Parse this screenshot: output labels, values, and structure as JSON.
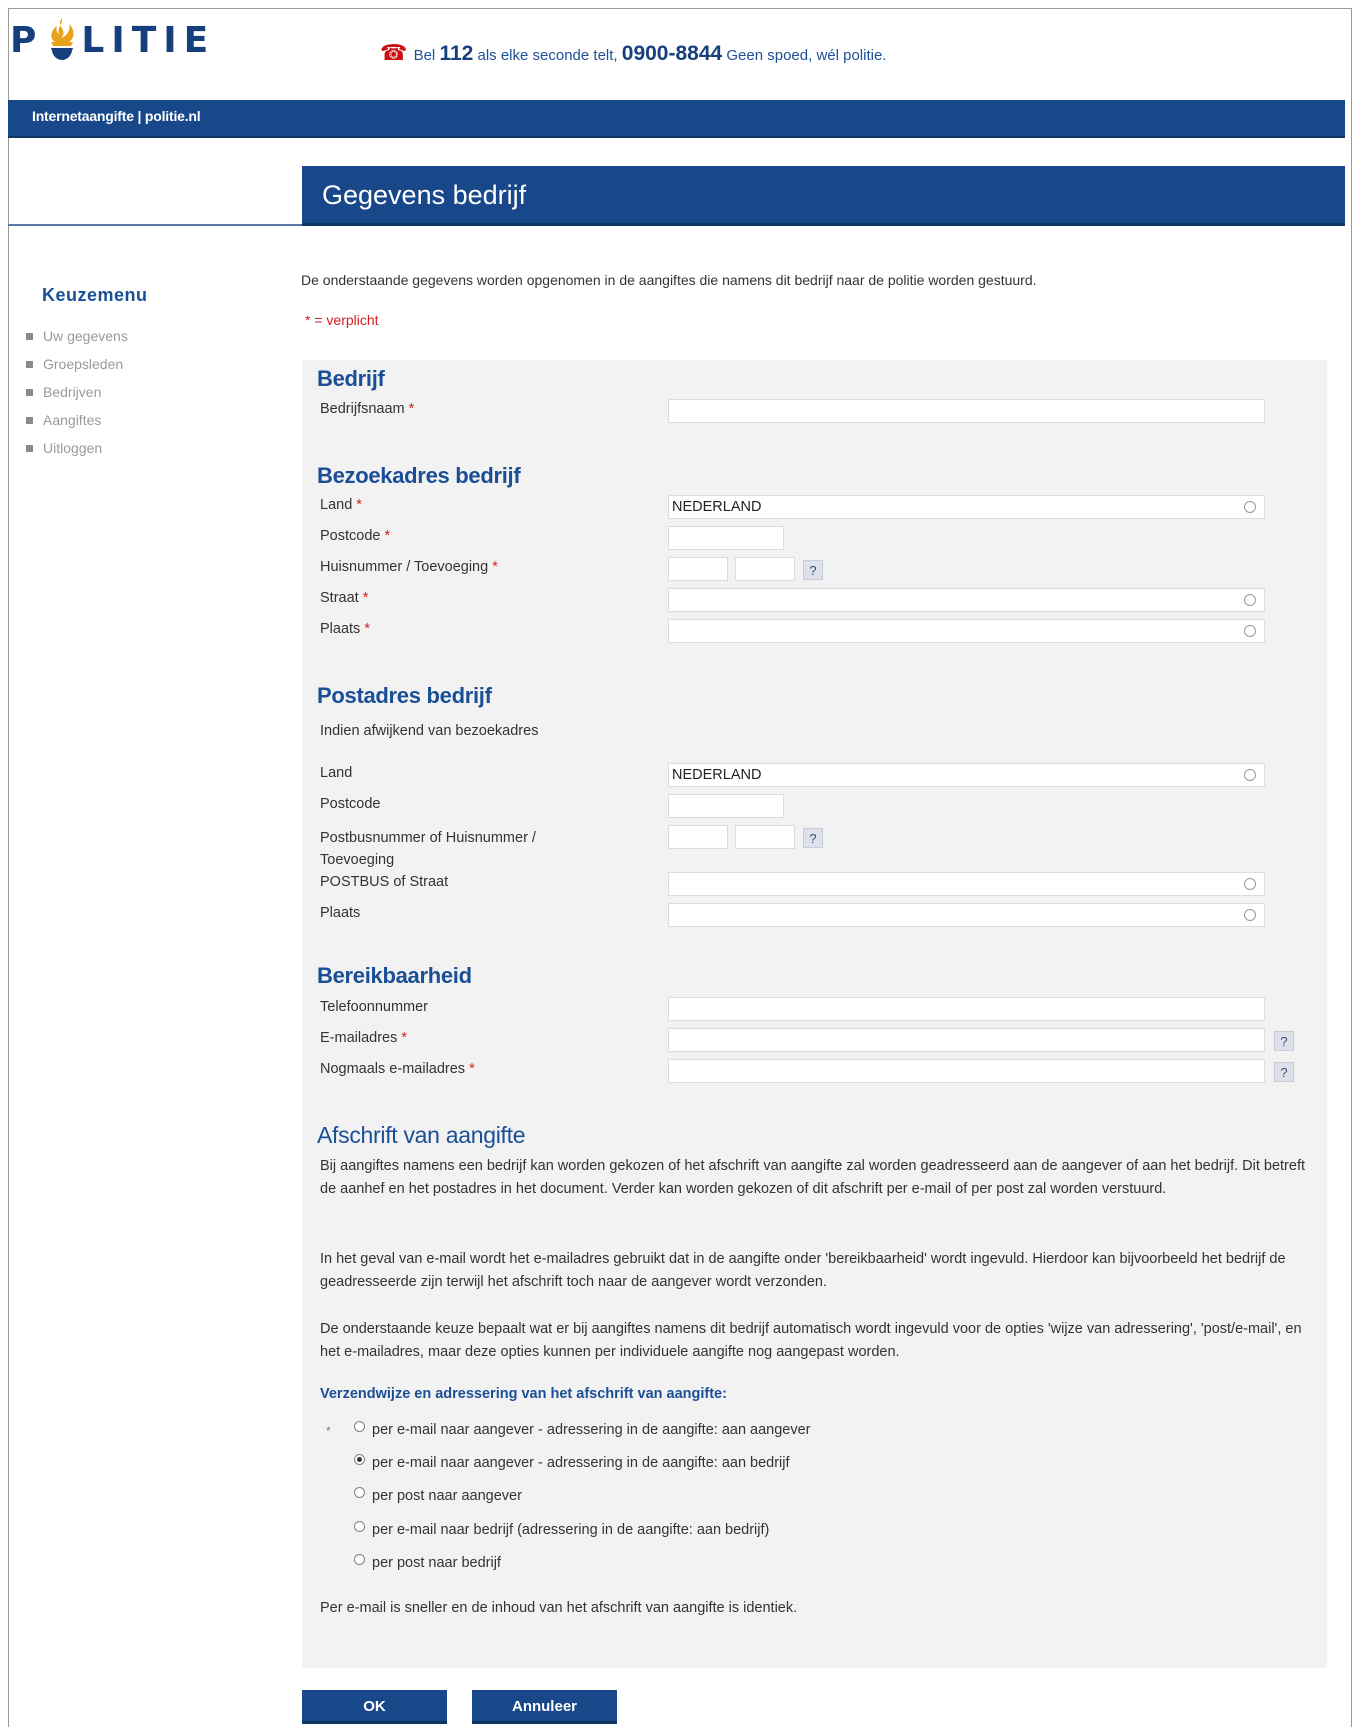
{
  "header": {
    "logo_text_left": "P",
    "logo_text_right": "LITIE",
    "tagline_prefix": "Bel",
    "tagline_emergency_number": "112",
    "tagline_mid": "als elke seconde telt,",
    "tagline_service_number": "0900-8844",
    "tagline_suffix": "Geen spoed, wél politie."
  },
  "topbar": {
    "label": "Internetaangifte | politie.nl"
  },
  "page_title": "Gegevens bedrijf",
  "menu": {
    "title": "Keuzemenu",
    "items": [
      {
        "label": "Uw gegevens"
      },
      {
        "label": "Groepsleden"
      },
      {
        "label": "Bedrijven"
      },
      {
        "label": "Aangiftes"
      },
      {
        "label": "Uitloggen"
      }
    ]
  },
  "intro": "De onderstaande gegevens worden opgenomen in de aangiftes die namens dit bedrijf naar de politie worden gestuurd.",
  "required_note": "* = verplicht",
  "required_marker": "*",
  "help_glyph": "?",
  "sections": {
    "bedrijf": {
      "heading": "Bedrijf",
      "bedrijfsnaam_label": "Bedrijfsnaam",
      "bedrijfsnaam_value": ""
    },
    "bezoekadres": {
      "heading": "Bezoekadres bedrijf",
      "land_label": "Land",
      "land_value": "NEDERLAND",
      "postcode_label": "Postcode",
      "huisnummer_label": "Huisnummer / Toevoeging",
      "straat_label": "Straat",
      "plaats_label": "Plaats"
    },
    "postadres": {
      "heading": "Postadres bedrijf",
      "note": "Indien afwijkend van bezoekadres",
      "land_label": "Land",
      "land_value": "NEDERLAND",
      "postcode_label": "Postcode",
      "postbus_label_line1": "Postbusnummer of Huisnummer /",
      "postbus_label_line2": "Toevoeging",
      "straat_label": "POSTBUS of Straat",
      "plaats_label": "Plaats"
    },
    "bereikbaarheid": {
      "heading": "Bereikbaarheid",
      "telefoon_label": "Telefoonnummer",
      "email_label": "E-mailadres",
      "email2_label": "Nogmaals e-mailadres"
    },
    "afschrift": {
      "heading": "Afschrift van aangifte",
      "para1": "Bij aangiftes namens een bedrijf kan worden gekozen of het afschrift van aangifte zal worden geadresseerd aan de aangever of aan het bedrijf. Dit betreft de aanhef en het postadres in het document. Verder kan worden gekozen of dit afschrift per e-mail of per post zal worden verstuurd.",
      "para2": "In het geval van e-mail wordt het e-mailadres gebruikt dat in de aangifte onder 'bereikbaarheid' wordt ingevuld. Hierdoor kan bijvoorbeeld het bedrijf de geadresseerde zijn terwijl het afschrift toch naar de aangever wordt verzonden.",
      "para3": "De onderstaande keuze bepaalt wat er bij aangiftes namens dit bedrijf automatisch wordt ingevuld voor de opties 'wijze van adressering', 'post/e-mail', en het e-mailadres, maar deze opties kunnen per individuele aangifte nog aangepast worden.",
      "subheading": "Verzendwijze en adressering van het afschrift van aangifte:",
      "options": [
        {
          "label": "per e-mail naar aangever - adressering in de aangifte: aan aangever",
          "selected": false
        },
        {
          "label": "per e-mail naar aangever - adressering in de aangifte: aan bedrijf",
          "selected": true
        },
        {
          "label": "per post naar aangever",
          "selected": false
        },
        {
          "label": "per e-mail naar bedrijf (adressering in de aangifte: aan bedrijf)",
          "selected": false
        },
        {
          "label": "per post naar bedrijf",
          "selected": false
        }
      ],
      "footer_note": "Per e-mail is sneller en de inhoud van het afschrift van aangifte is identiek."
    }
  },
  "buttons": {
    "ok": "OK",
    "cancel": "Annuleer"
  },
  "colors": {
    "brand_blue": "#18488a",
    "heading_blue": "#1a4f96",
    "required_red": "#d42020",
    "form_bg": "#f2f2f2"
  }
}
